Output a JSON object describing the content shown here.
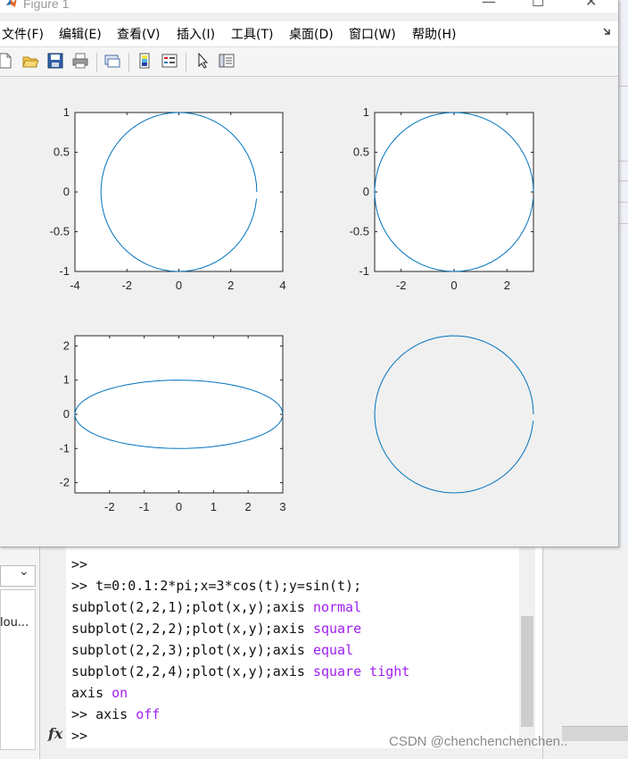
{
  "figure": {
    "title": "Figure 1",
    "window_buttons": {
      "minimize": "—",
      "maximize": "☐",
      "close": "✕"
    },
    "menu": [
      "文件(F)",
      "编辑(E)",
      "查看(V)",
      "插入(I)",
      "工具(T)",
      "桌面(D)",
      "窗口(W)",
      "帮助(H)"
    ],
    "toolbar_icons": [
      "new-figure-icon",
      "open-file-icon",
      "save-icon",
      "print-icon",
      "link-plot-icon",
      "insert-colorbar-icon",
      "insert-legend-icon",
      "edit-plot-arrow-icon",
      "property-inspector-icon"
    ]
  },
  "colors": {
    "line": "#0072bd",
    "purple_keyword": "#a020f0",
    "axes_bg": "#ffffff",
    "figure_bg": "#f0f0f0"
  },
  "chart_data": [
    {
      "type": "line",
      "subplot": "2,2,1",
      "axis_mode": "normal",
      "curve": "x=3*cos(t), y=sin(t), t=0:0.1:2*pi",
      "xlim": [
        -4,
        4
      ],
      "ylim": [
        -1,
        1
      ],
      "xticks": [
        "-4",
        "-2",
        "0",
        "2",
        "4"
      ],
      "yticks": [
        "1",
        "0.5",
        "0",
        "-0.5",
        "-1"
      ]
    },
    {
      "type": "line",
      "subplot": "2,2,2",
      "axis_mode": "square",
      "curve": "x=3*cos(t), y=sin(t), t=0:0.1:2*pi",
      "xlim": [
        -3,
        3
      ],
      "ylim": [
        -1,
        1
      ],
      "xticks": [
        "-2",
        "0",
        "2"
      ],
      "yticks": [
        "1",
        "0.5",
        "0",
        "-0.5",
        "-1"
      ]
    },
    {
      "type": "line",
      "subplot": "2,2,3",
      "axis_mode": "equal",
      "curve": "x=3*cos(t), y=sin(t), t=0:0.1:2*pi",
      "xlim": [
        -3,
        3
      ],
      "ylim": [
        -2.3,
        2.3
      ],
      "xticks": [
        "-2",
        "-1",
        "0",
        "1",
        "2",
        "3"
      ],
      "yticks": [
        "2",
        "1",
        "0",
        "-1",
        "-2"
      ]
    },
    {
      "type": "line",
      "subplot": "2,2,4",
      "axis_mode": "square tight (axis off)",
      "curve": "x=3*cos(t), y=sin(t), t=0:0.1:2*pi",
      "xlim": [
        -3,
        3
      ],
      "ylim": [
        -1,
        1
      ],
      "xticks": [],
      "yticks": []
    }
  ],
  "command_window": {
    "lines": [
      {
        "text": ">>"
      },
      {
        "text": ">> t=0:0.1:2*pi;x=3*cos(t);y=sin(t);"
      },
      {
        "text": "subplot(2,2,1);plot(x,y);axis ",
        "kw": "normal"
      },
      {
        "text": "subplot(2,2,2);plot(x,y);axis ",
        "kw": "square"
      },
      {
        "text": "subplot(2,2,3);plot(x,y);axis ",
        "kw": "equal"
      },
      {
        "text": "subplot(2,2,4);plot(x,y);axis ",
        "kw": "square tight"
      },
      {
        "text": "axis ",
        "kw": "on"
      },
      {
        "text": ">> axis ",
        "kw": "off"
      },
      {
        "text": ">>"
      }
    ],
    "fx_label": "fx"
  },
  "workspace_panel": {
    "dropdown_arrow": "⌄",
    "item": "lou..."
  },
  "watermark": "CSDN @chenchenchenchen.."
}
